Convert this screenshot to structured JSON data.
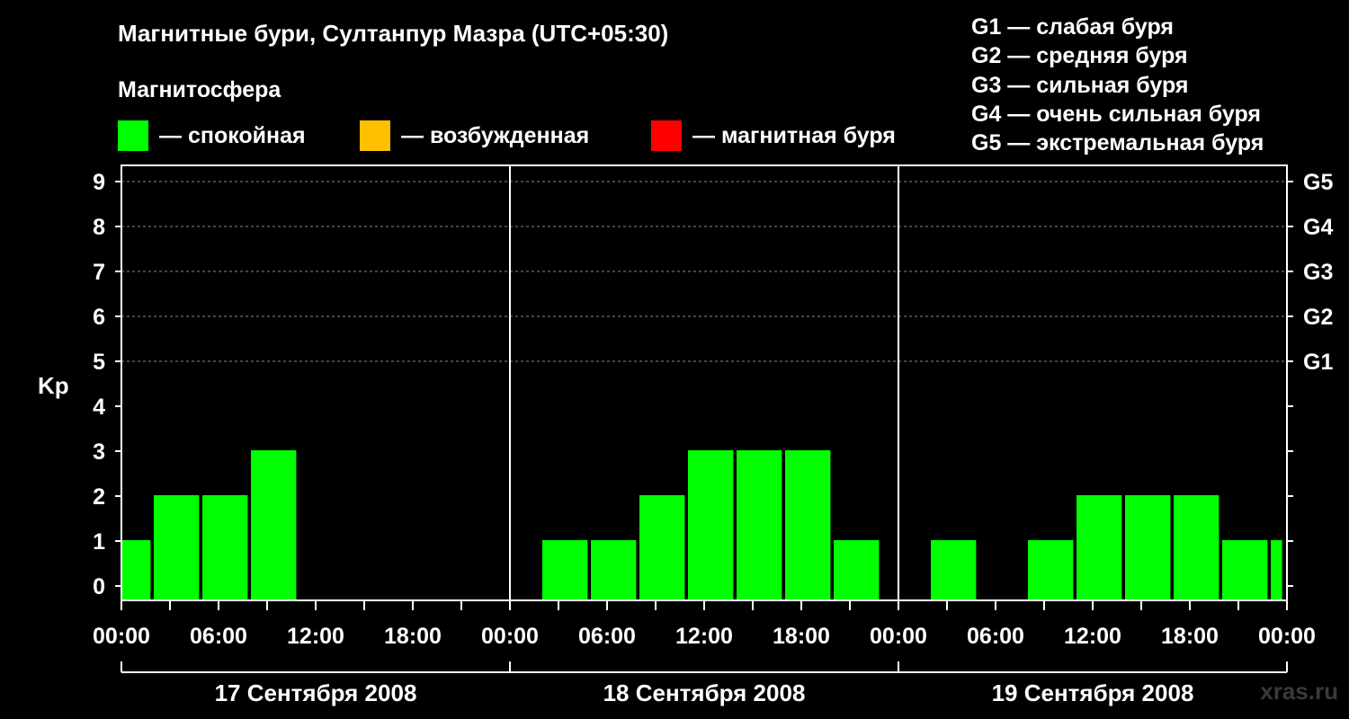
{
  "title": "Магнитные бури, Султанпур Мазра (UTC+05:30)",
  "subtitle": "Магнитосфера",
  "legend": [
    {
      "label": "— спокойная",
      "color": "#00ff00"
    },
    {
      "label": "— возбужденная",
      "color": "#ffc000"
    },
    {
      "label": "— магнитная буря",
      "color": "#ff0000"
    }
  ],
  "g_scale": [
    "G1 — слабая буря",
    "G2 — средняя буря",
    "G3 — сильная буря",
    "G4 — очень сильная буря",
    "G5 — экстремальная буря"
  ],
  "watermark": "xras.ru",
  "chart_data": {
    "type": "bar",
    "ylabel": "Kp",
    "ylim": [
      0,
      9
    ],
    "yticks": [
      0,
      1,
      2,
      3,
      4,
      5,
      6,
      7,
      8,
      9
    ],
    "right_labels": [
      {
        "kp": 5,
        "label": "G1"
      },
      {
        "kp": 6,
        "label": "G2"
      },
      {
        "kp": 7,
        "label": "G3"
      },
      {
        "kp": 8,
        "label": "G4"
      },
      {
        "kp": 9,
        "label": "G5"
      }
    ],
    "time_range_hours": [
      0,
      72
    ],
    "xtick_labels": [
      "00:00",
      "06:00",
      "12:00",
      "18:00",
      "00:00",
      "06:00",
      "12:00",
      "18:00",
      "00:00",
      "06:00",
      "12:00",
      "18:00",
      "00:00"
    ],
    "days": [
      "17 Сентября 2008",
      "18 Сентября 2008",
      "19 Сентября 2008"
    ],
    "bar_color": "#00ff00",
    "bars": [
      {
        "start": 0,
        "end": 1.8,
        "kp": 1
      },
      {
        "start": 2.0,
        "end": 4.8,
        "kp": 2
      },
      {
        "start": 5.0,
        "end": 7.8,
        "kp": 2
      },
      {
        "start": 8.0,
        "end": 10.8,
        "kp": 3
      },
      {
        "start": 26.0,
        "end": 28.8,
        "kp": 1
      },
      {
        "start": 29.0,
        "end": 31.8,
        "kp": 1
      },
      {
        "start": 32.0,
        "end": 34.8,
        "kp": 2
      },
      {
        "start": 35.0,
        "end": 37.8,
        "kp": 3
      },
      {
        "start": 38.0,
        "end": 40.8,
        "kp": 3
      },
      {
        "start": 41.0,
        "end": 43.8,
        "kp": 3
      },
      {
        "start": 44.0,
        "end": 46.8,
        "kp": 1
      },
      {
        "start": 50.0,
        "end": 52.8,
        "kp": 1
      },
      {
        "start": 56.0,
        "end": 58.8,
        "kp": 1
      },
      {
        "start": 59.0,
        "end": 61.8,
        "kp": 2
      },
      {
        "start": 62.0,
        "end": 64.8,
        "kp": 2
      },
      {
        "start": 65.0,
        "end": 67.8,
        "kp": 2
      },
      {
        "start": 68.0,
        "end": 70.8,
        "kp": 1
      },
      {
        "start": 71.0,
        "end": 71.7,
        "kp": 1
      }
    ]
  }
}
